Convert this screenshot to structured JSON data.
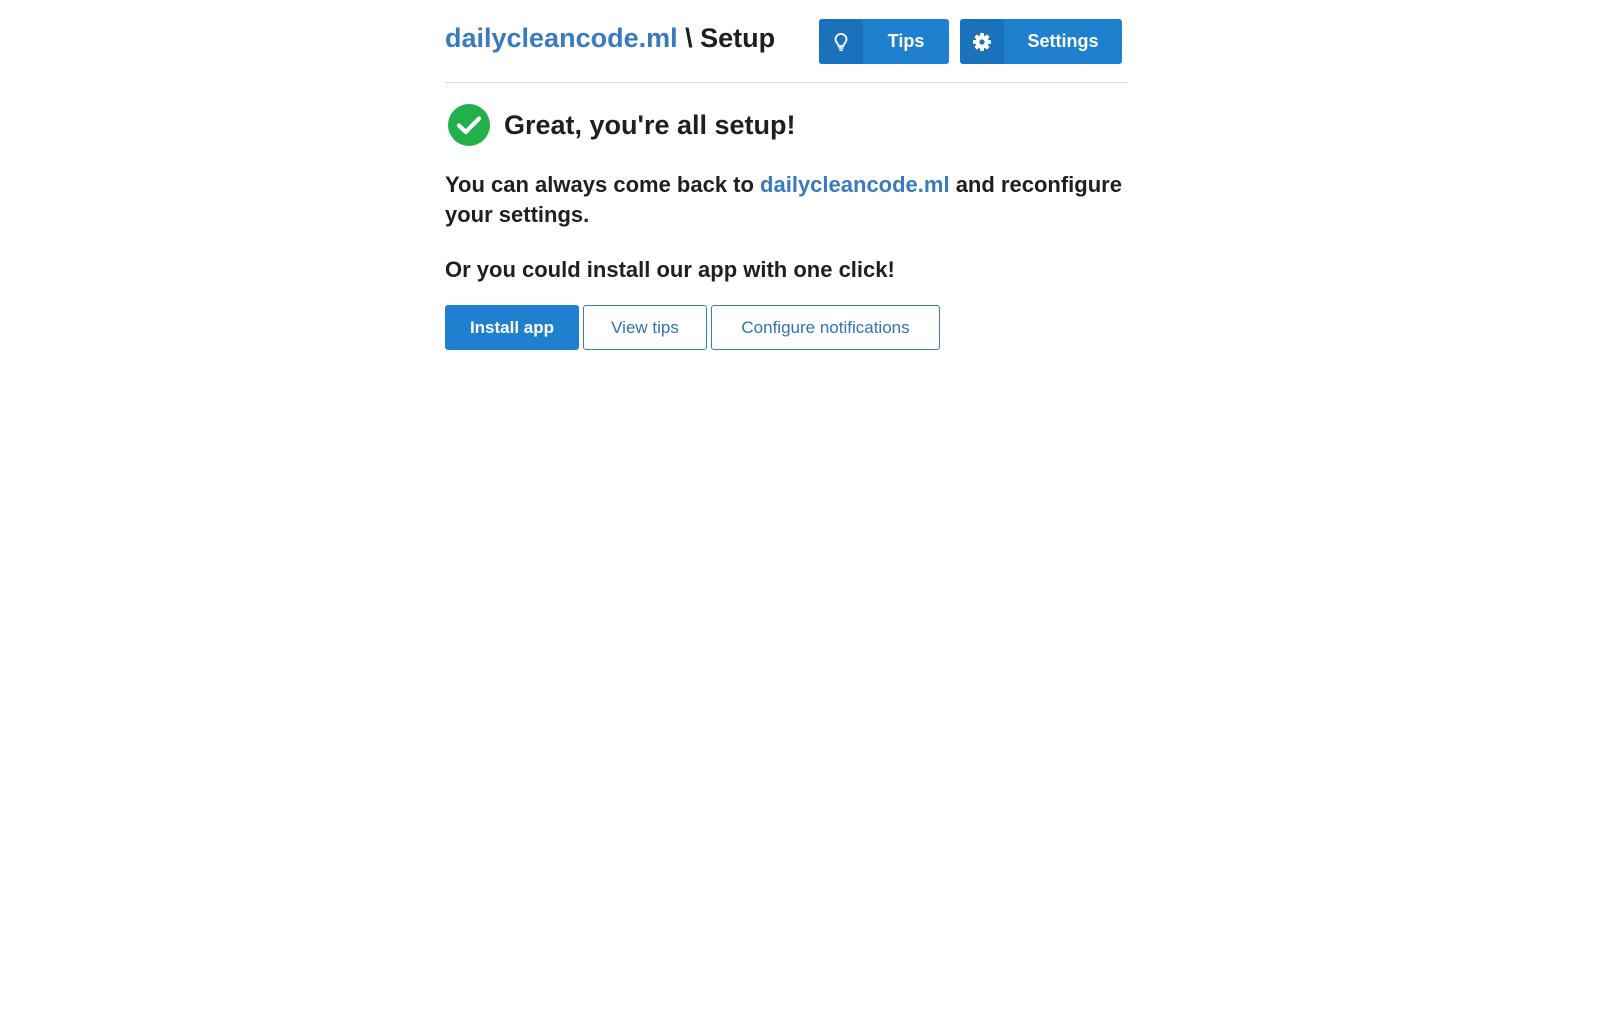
{
  "header": {
    "site_link": "dailycleancode.ml",
    "separator": " \\ ",
    "page": "Setup",
    "tips_label": "Tips",
    "tips_icon": "lightbulb-icon",
    "settings_label": "Settings",
    "settings_icon": "gear-icon"
  },
  "main": {
    "success_heading": "Great, you're all setup!",
    "success_icon": "check-circle-icon",
    "paragraph1_before": "You can always come back to ",
    "paragraph1_link": "dailycleancode.ml",
    "paragraph1_after": " and reconfigure your settings.",
    "paragraph2": "Or you could install our app with one click!",
    "install_label": "Install app",
    "view_tips_label": "View tips",
    "configure_label": "Configure notifications"
  },
  "colors": {
    "primary": "#1f80cf",
    "link": "#3a7bbf",
    "success": "#22b04b"
  }
}
